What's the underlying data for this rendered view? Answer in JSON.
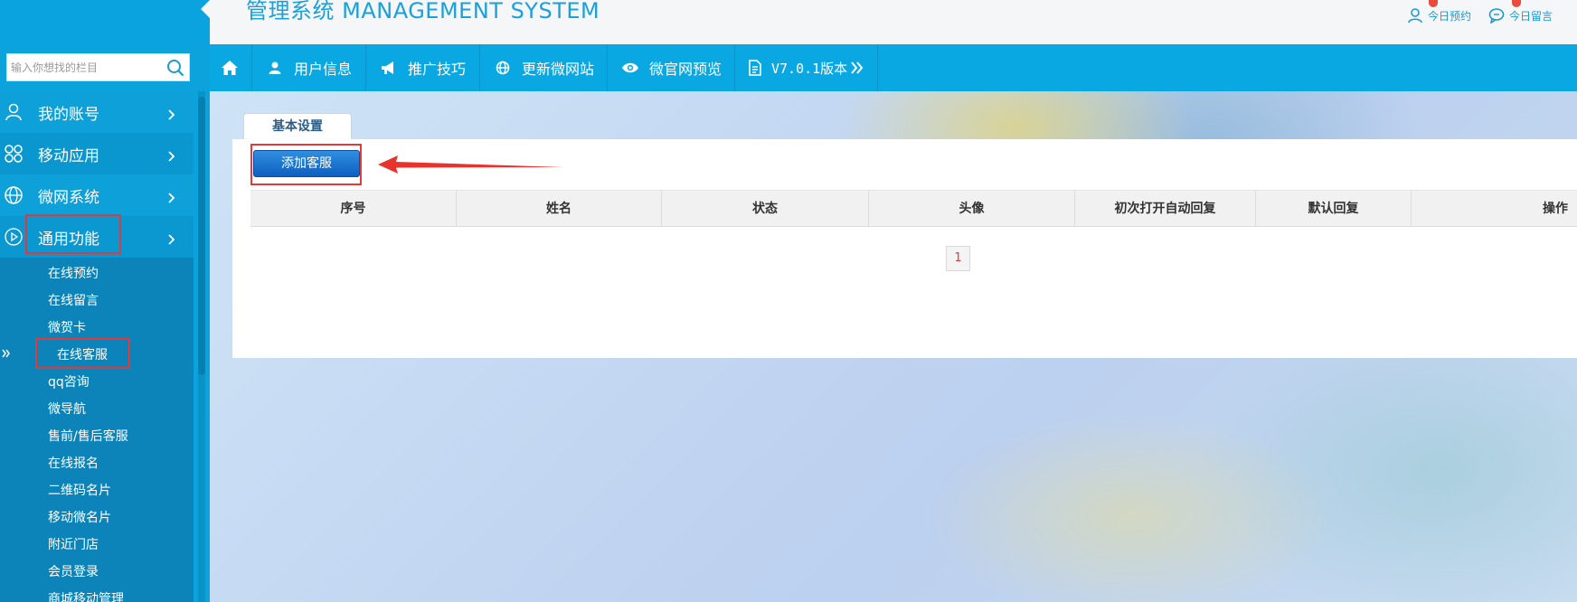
{
  "header": {
    "title": "管理系统 MANAGEMENT SYSTEM",
    "links": [
      {
        "label": "今日预约",
        "icon": "user-icon"
      },
      {
        "label": "今日留言",
        "icon": "message-icon"
      }
    ]
  },
  "navbar": {
    "items": [
      {
        "label": "",
        "icon": "home-icon"
      },
      {
        "label": "用户信息",
        "icon": "user-icon"
      },
      {
        "label": "推广技巧",
        "icon": "megaphone-icon"
      },
      {
        "label": "更新微网站",
        "icon": "globe-icon"
      },
      {
        "label": "微官网预览",
        "icon": "eye-icon"
      },
      {
        "label": "V7.0.1版本",
        "icon": "document-icon"
      }
    ]
  },
  "sidebar": {
    "search": {
      "placeholder": "输入你想找的栏目",
      "value": ""
    },
    "menus": [
      {
        "label": "我的账号",
        "icon": "user-icon"
      },
      {
        "label": "移动应用",
        "icon": "grid-icon"
      },
      {
        "label": "微网系统",
        "icon": "globe-icon"
      },
      {
        "label": "通用功能",
        "icon": "play-circle-icon"
      }
    ],
    "submenu": [
      "在线预约",
      "在线留言",
      "微贺卡",
      "在线客服",
      "qq咨询",
      "微导航",
      "售前/售后客服",
      "在线报名",
      "二维码名片",
      "移动微名片",
      "附近门店",
      "会员登录",
      "商城移动管理"
    ],
    "active_submenu": "在线客服"
  },
  "main": {
    "tab": "基本设置",
    "add_button": "添加客服",
    "columns": [
      "序号",
      "姓名",
      "状态",
      "头像",
      "初次打开自动回复",
      "默认回复",
      "操作"
    ],
    "rows": [],
    "pagination": {
      "current": "1"
    }
  },
  "colors": {
    "accent": "#0aa3df",
    "sidebar": "#0ca3dc",
    "submenu": "#0c84b9",
    "highlight": "#e23a3a",
    "button": "#1776d0"
  }
}
